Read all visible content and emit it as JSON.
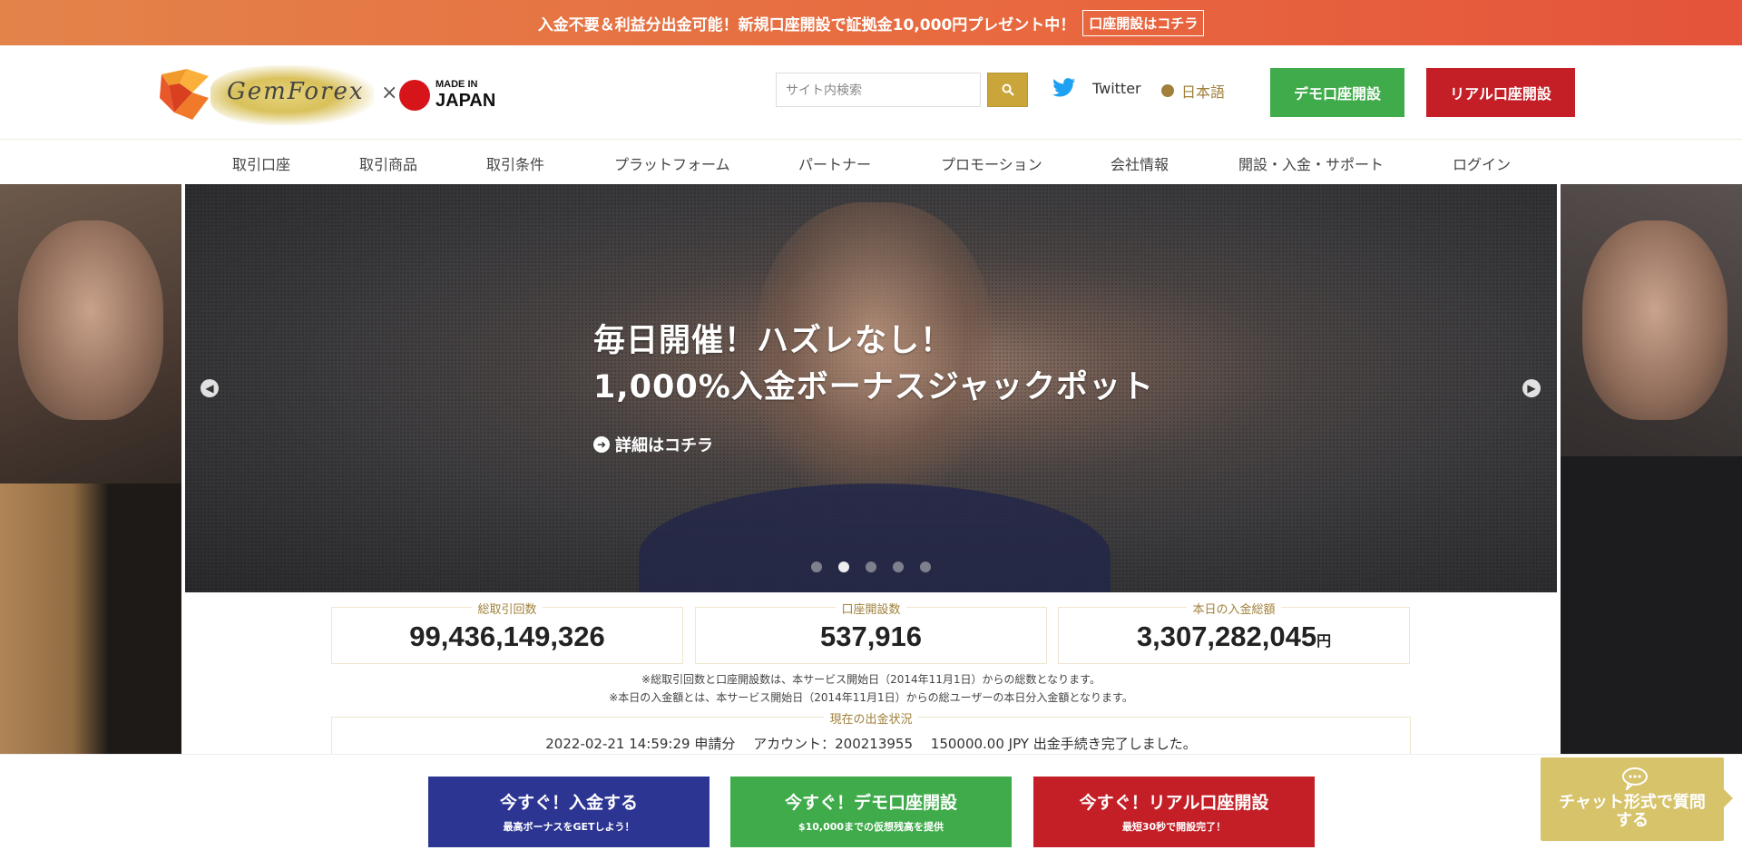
{
  "promo": {
    "text": "入金不要＆利益分出金可能！新規口座開設で証拠金10,000円プレゼント中！",
    "link": "口座開設はコチラ"
  },
  "header": {
    "brand": "GemForex",
    "times": "×",
    "made_in_1": "MADE IN",
    "made_in_2": "JAPAN",
    "search_placeholder": "サイト内検索",
    "twitter": "Twitter",
    "language": "日本語",
    "demo_button": "デモ口座開設",
    "real_button": "リアル口座開設"
  },
  "nav": {
    "items": [
      "取引口座",
      "取引商品",
      "取引条件",
      "プラットフォーム",
      "パートナー",
      "プロモーション",
      "会社情報",
      "開設・入金・サポート",
      "ログイン"
    ]
  },
  "hero": {
    "title_line1": "毎日開催！ハズレなし！",
    "title_line2": "1,000%入金ボーナスジャックポット",
    "more": "詳細はコチラ",
    "slides": 5,
    "active_slide": 2
  },
  "stats": [
    {
      "label": "総取引回数",
      "value": "99,436,149,326",
      "unit": ""
    },
    {
      "label": "口座開設数",
      "value": "537,916",
      "unit": ""
    },
    {
      "label": "本日の入金総額",
      "value": "3,307,282,045",
      "unit": "円"
    }
  ],
  "notes": {
    "line1": "※総取引回数と口座開設数は、本サービス開始日（2014年11月1日）からの総数となります。",
    "line2": "※本日の入金額とは、本サービス開始日（2014年11月1日）からの総ユーザーの本日分入金額となります。"
  },
  "withdrawal": {
    "label": "現在の出金状況",
    "text": "2022-02-21 14:59:29 申請分　 アカウント：200213955　 150000.00 JPY 出金手続き完了しました。"
  },
  "bottom": {
    "deposit_title": "今すぐ！入金する",
    "deposit_sub": "最高ボーナスをGETしよう！",
    "demo_title": "今すぐ！デモ口座開設",
    "demo_sub": "$10,000までの仮想残高を提供",
    "real_title": "今すぐ！リアル口座開設",
    "real_sub": "最短30秒で開設完了！"
  },
  "chat": {
    "text_line1": "チャット形式で質問",
    "text_line2": "する"
  },
  "colors": {
    "gold": "#c9a53a",
    "green": "#3fab4a",
    "red": "#c41f26",
    "blue": "#2d3592",
    "chat": "#d6c36a"
  }
}
